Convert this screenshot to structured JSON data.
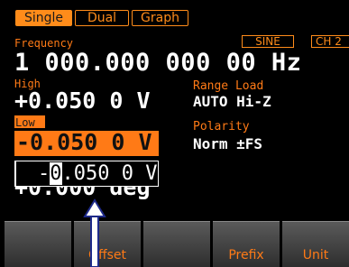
{
  "tabs": {
    "single": "Single",
    "dual": "Dual",
    "graph": "Graph"
  },
  "status": {
    "waveform": "SINE",
    "channel": "CH 2"
  },
  "frequency": {
    "label": "Frequency",
    "value": "1 000.000 000 00 Hz"
  },
  "high": {
    "label": "High",
    "value": "+0.050 0 V"
  },
  "range_load": {
    "label": "Range Load",
    "value": "AUTO Hi-Z"
  },
  "low": {
    "label": "Low",
    "value": "-0.050 0 V"
  },
  "polarity": {
    "label": "Polarity",
    "value": "Norm ±FS"
  },
  "phase_partial": {
    "value": "+0.000 deg"
  },
  "edit": {
    "sign": "-",
    "cursor_digit": "0",
    "rest": ".050 0 V"
  },
  "softkeys": {
    "k1": "",
    "k2": "Offset",
    "k3": "",
    "k4": "Prefix",
    "k5": "Unit"
  },
  "colors": {
    "accent": "#ff7a16",
    "background": "#000000",
    "text": "#ffffff"
  }
}
